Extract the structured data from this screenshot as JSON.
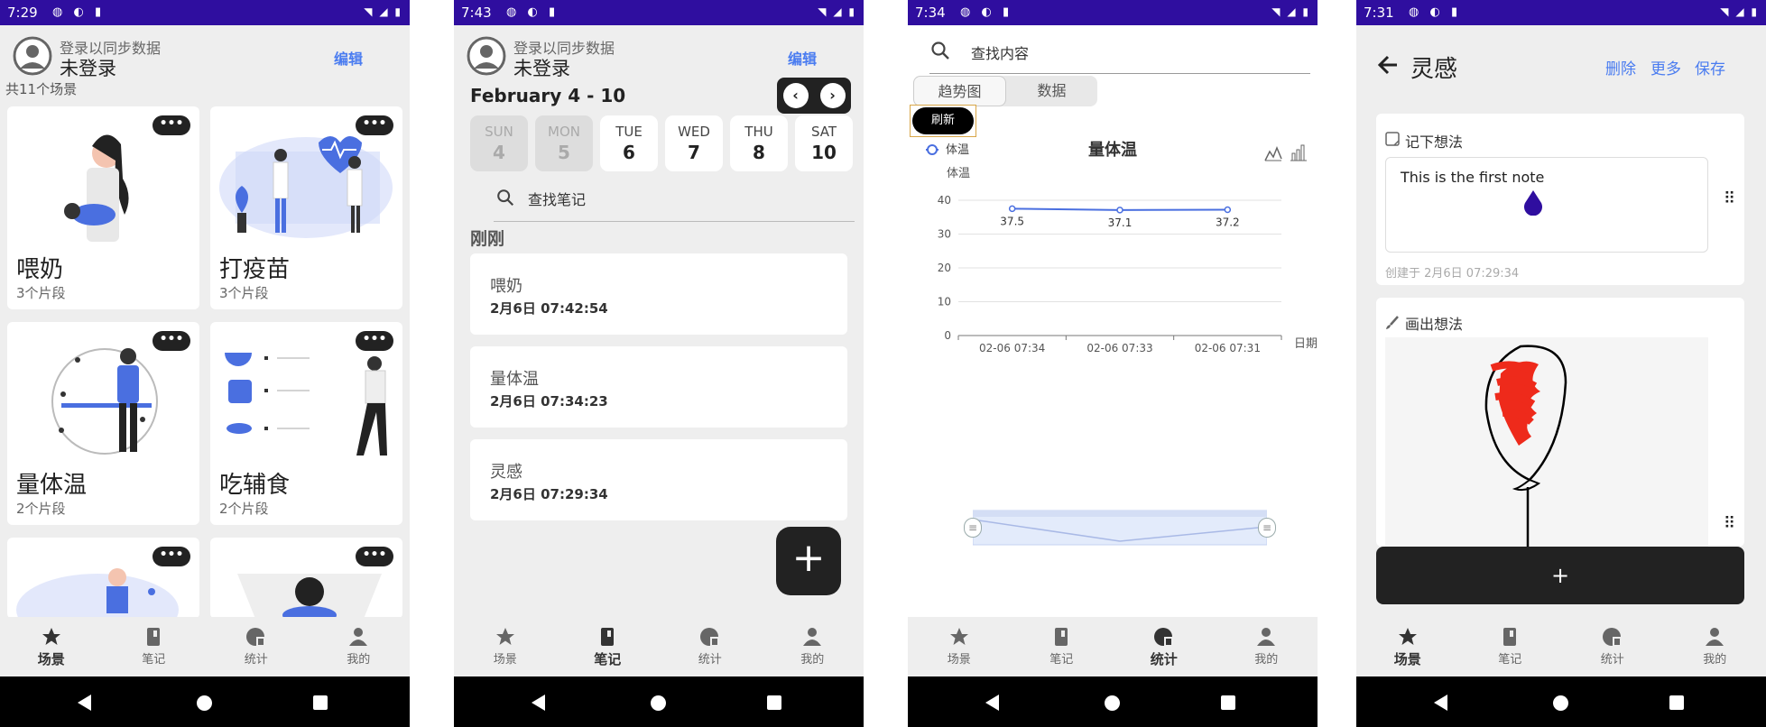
{
  "colors": {
    "statusbar": "#2f0e9f",
    "accent": "#4a7cf0",
    "dark": "#222222"
  },
  "nav": {
    "scene": "场景",
    "notes": "笔记",
    "stats": "统计",
    "me": "我的"
  },
  "s1": {
    "time": "7:29",
    "login_hint": "登录以同步数据",
    "login_status": "未登录",
    "edit": "编辑",
    "scene_count": "共11个场景",
    "more": "•••",
    "cards": [
      {
        "title": "喂奶",
        "count": "3个片段"
      },
      {
        "title": "打疫苗",
        "count": "3个片段"
      },
      {
        "title": "量体温",
        "count": "2个片段"
      },
      {
        "title": "吃辅食",
        "count": "2个片段"
      }
    ]
  },
  "s2": {
    "time": "7:43",
    "login_hint": "登录以同步数据",
    "login_status": "未登录",
    "edit": "编辑",
    "week": "February 4 - 10",
    "prev": "‹",
    "next": "›",
    "days": [
      {
        "name": "SUN",
        "num": "4"
      },
      {
        "name": "MON",
        "num": "5"
      },
      {
        "name": "TUE",
        "num": "6"
      },
      {
        "name": "WED",
        "num": "7"
      },
      {
        "name": "THU",
        "num": "8"
      },
      {
        "name": "SAT",
        "num": "10"
      }
    ],
    "search_placeholder": "查找笔记",
    "section": "刚刚",
    "notes": [
      {
        "title": "喂奶",
        "date": "2月6日 07:42:54"
      },
      {
        "title": "量体温",
        "date": "2月6日 07:34:23"
      },
      {
        "title": "灵感",
        "date": "2月6日 07:29:34"
      }
    ],
    "fab": "+"
  },
  "s3": {
    "time": "7:34",
    "search_placeholder": "查找内容",
    "tab_trend": "趋势图",
    "tab_data": "数据",
    "refresh": "刷新",
    "chart_data": {
      "type": "line",
      "title": "量体温",
      "xlabel": "日期",
      "ylabel": "体温",
      "categories": [
        "02-06 07:34",
        "02-06 07:33",
        "02-06 07:31"
      ],
      "series": [
        {
          "name": "体温",
          "values": [
            37.5,
            37.1,
            37.2
          ]
        }
      ],
      "ylim": [
        0,
        40
      ],
      "yticks": [
        0,
        10,
        20,
        30,
        40
      ],
      "grid": true,
      "legend": "top-left"
    }
  },
  "s4": {
    "time": "7:31",
    "title": "灵感",
    "delete": "删除",
    "more": "更多",
    "save": "保存",
    "note_header": "记下想法",
    "note_text": "This is the first note",
    "created": "创建于 2月6日 07:29:34",
    "draw_header": "画出想法",
    "add": "+"
  }
}
